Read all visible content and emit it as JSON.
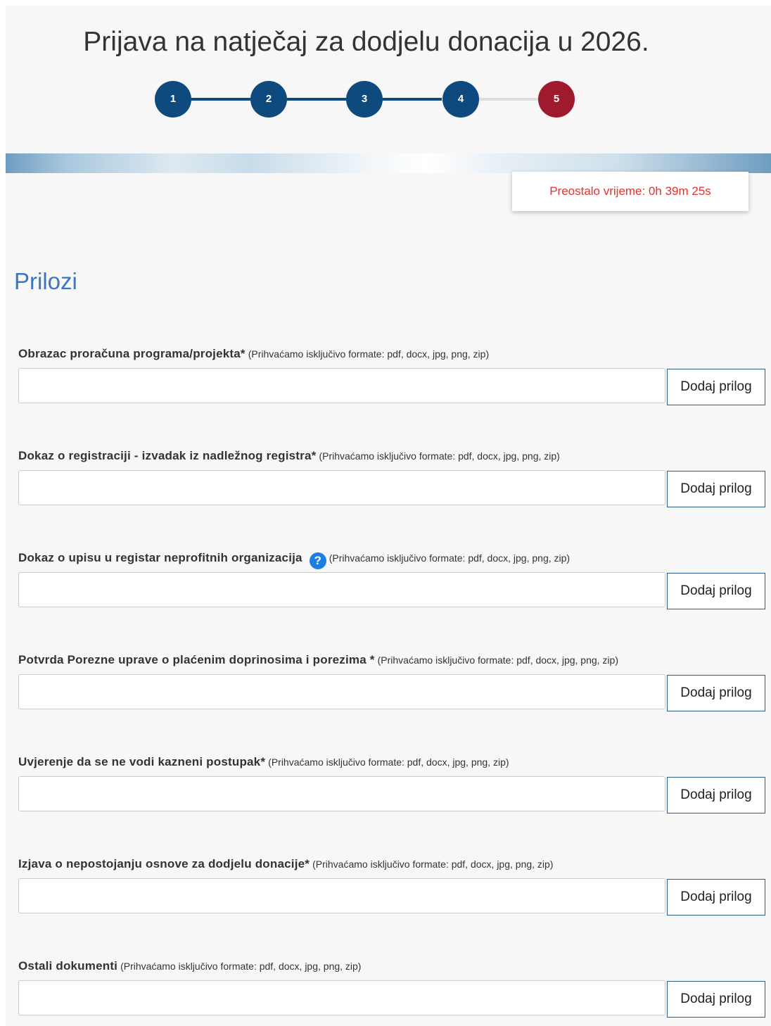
{
  "header": {
    "title": "Prijava na natječaj za dodjelu donacija u 2026."
  },
  "stepper": {
    "steps": [
      {
        "label": "1",
        "state": "completed",
        "color": "#0f4a7e"
      },
      {
        "label": "2",
        "state": "completed",
        "color": "#0f4a7e"
      },
      {
        "label": "3",
        "state": "completed",
        "color": "#0f4a7e"
      },
      {
        "label": "4",
        "state": "completed",
        "color": "#0f4a7e"
      },
      {
        "label": "5",
        "state": "current",
        "color": "#a01a2e"
      }
    ],
    "completed_line_color": "#0f4a7e",
    "pending_line_color": "#dddddd"
  },
  "timer": {
    "text": "Preostalo vrijeme: 0h 39m 25s",
    "color": "#e0342f"
  },
  "section": {
    "title": "Prilozi"
  },
  "fields": [
    {
      "label": "Obrazac proračuna programa/projekta*",
      "help": false,
      "hint": "(Prihvaćamo isključivo formate: pdf, docx, jpg, png, zip)",
      "button": "Dodaj prilog",
      "value": ""
    },
    {
      "label": "Dokaz o registraciji - izvadak iz nadležnog registra*",
      "help": false,
      "hint": "(Prihvaćamo isključivo formate: pdf, docx, jpg, png, zip)",
      "button": "Dodaj prilog",
      "value": ""
    },
    {
      "label": "Dokaz o upisu u registar neprofitnih organizacija",
      "help": true,
      "help_icon": "question-icon",
      "help_symbol": "?",
      "hint": "(Prihvaćamo isključivo formate: pdf, docx, jpg, png, zip)",
      "button": "Dodaj prilog",
      "value": ""
    },
    {
      "label": "Potvrda Porezne uprave o plaćenim doprinosima i porezima *",
      "help": false,
      "hint": "(Prihvaćamo isključivo formate: pdf, docx, jpg, png, zip)",
      "button": "Dodaj prilog",
      "value": ""
    },
    {
      "label": "Uvjerenje da se ne vodi kazneni postupak*",
      "help": false,
      "hint": "(Prihvaćamo isključivo formate: pdf, docx, jpg, png, zip)",
      "button": "Dodaj prilog",
      "value": ""
    },
    {
      "label": "Izjava o nepostojanju osnove za dodjelu donacije*",
      "help": false,
      "hint": "(Prihvaćamo isključivo formate: pdf, docx, jpg, png, zip)",
      "button": "Dodaj prilog",
      "value": ""
    },
    {
      "label": "Ostali dokumenti",
      "help": false,
      "hint": "(Prihvaćamo isključivo formate: pdf, docx, jpg, png, zip)",
      "button": "Dodaj prilog",
      "value": ""
    }
  ]
}
